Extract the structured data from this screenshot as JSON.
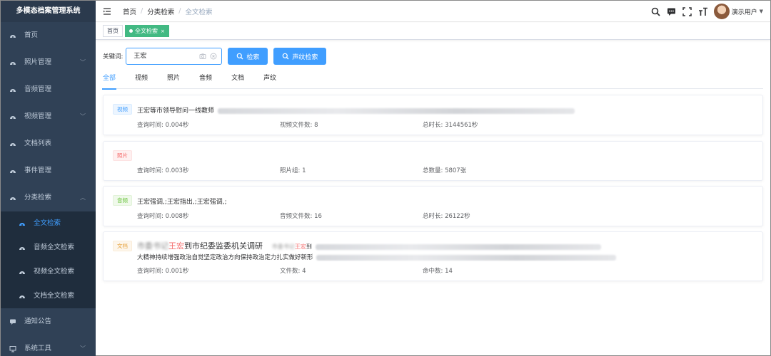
{
  "app": {
    "title": "多模态档案管理系统"
  },
  "sidebar": {
    "items": [
      {
        "label": "首页",
        "icon": "dashboard-icon"
      },
      {
        "label": "照片管理",
        "icon": "dashboard-icon",
        "arrow": "﹀"
      },
      {
        "label": "音频管理",
        "icon": "dashboard-icon"
      },
      {
        "label": "视频管理",
        "icon": "dashboard-icon",
        "arrow": "﹀"
      },
      {
        "label": "文档列表",
        "icon": "dashboard-icon"
      },
      {
        "label": "事件管理",
        "icon": "dashboard-icon"
      },
      {
        "label": "分类检索",
        "icon": "dashboard-icon",
        "arrow": "︿"
      }
    ],
    "sub": [
      {
        "label": "全文检索"
      },
      {
        "label": "音频全文检索"
      },
      {
        "label": "视频全文检索"
      },
      {
        "label": "文档全文检索"
      }
    ],
    "tail": [
      {
        "label": "通知公告",
        "arrow": ""
      },
      {
        "label": "系统工具",
        "arrow": "﹀"
      }
    ]
  },
  "breadcrumb": {
    "home": "首页",
    "section": "分类检索",
    "current": "全文检索"
  },
  "user": {
    "name": "演示用户"
  },
  "tags": {
    "home": "首页",
    "active": "全文检索"
  },
  "search": {
    "label": "关键词:",
    "value": "王宏",
    "search_button": "检索",
    "voice_button": "声纹检索"
  },
  "tabs": [
    "全部",
    "视频",
    "照片",
    "音频",
    "文档",
    "声纹"
  ],
  "results": [
    {
      "badge": "视频",
      "snippet": "王宏等市领导慰问一线教师",
      "stats": [
        {
          "label": "查询时间:",
          "value": "0.004秒"
        },
        {
          "label": "视频文件数:",
          "value": "8"
        },
        {
          "label": "总时长:",
          "value": "3144561秒"
        }
      ]
    },
    {
      "badge": "照片",
      "snippet": "",
      "stats": [
        {
          "label": "查询时间:",
          "value": "0.003秒"
        },
        {
          "label": "照片组:",
          "value": "1"
        },
        {
          "label": "总数量:",
          "value": "5807张"
        }
      ]
    },
    {
      "badge": "音频",
      "snippet": "王宏强调,;王宏指出,;王宏强调,;",
      "stats": [
        {
          "label": "查询时间:",
          "value": "0.008秒"
        },
        {
          "label": "音频文件数:",
          "value": "16"
        },
        {
          "label": "总时长:",
          "value": "26122秒"
        }
      ]
    },
    {
      "badge": "文档",
      "title_pre": "市委书记",
      "title_hl": "王宏",
      "title_post": "到市纪委监委机关调研",
      "mid_pre": "市委书记",
      "mid_hl": "王宏",
      "mid_post": "到",
      "line2": "大精神持续增强政治自觉坚定政治方向保持政治定力扎实做好新形",
      "stats": [
        {
          "label": "查询时间:",
          "value": "0.001秒"
        },
        {
          "label": "文件数:",
          "value": "4"
        },
        {
          "label": "命中数:",
          "value": "14"
        }
      ]
    }
  ],
  "colors": {
    "sidebar": "#304156",
    "primary": "#409eff",
    "tag_active": "#42b983",
    "highlight": "#f56c6c"
  }
}
